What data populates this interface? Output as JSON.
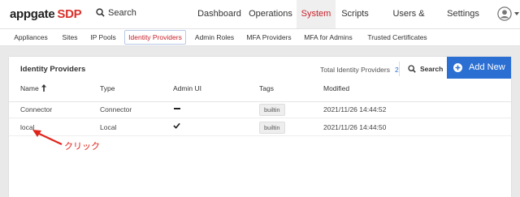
{
  "header": {
    "logo_left": "appgate",
    "logo_right": "SDP",
    "search_label": "Search",
    "nav": [
      {
        "label": "Dashboard"
      },
      {
        "label": "Operations"
      },
      {
        "label": "System",
        "active": true
      },
      {
        "label": "Scripts"
      },
      {
        "label": "Users & Devices"
      },
      {
        "label": "Settings"
      }
    ]
  },
  "subnav": {
    "items": [
      {
        "label": "Appliances"
      },
      {
        "label": "Sites"
      },
      {
        "label": "IP Pools"
      },
      {
        "label": "Identity Providers",
        "active": true
      },
      {
        "label": "Admin Roles"
      },
      {
        "label": "MFA Providers"
      },
      {
        "label": "MFA for Admins"
      },
      {
        "label": "Trusted Certificates"
      }
    ]
  },
  "panel": {
    "title": "Identity Providers",
    "total_label": "Total Identity Providers",
    "total_count": "2",
    "search_label": "Search",
    "add_label": "Add New",
    "columns": [
      "Name",
      "Type",
      "Admin UI",
      "Tags",
      "Modified"
    ],
    "rows": [
      {
        "name": "Connector",
        "type": "Connector",
        "admin_ui": "dash",
        "tag": "builtin",
        "modified": "2021/11/26 14:44:52"
      },
      {
        "name": "local",
        "type": "Local",
        "admin_ui": "check",
        "tag": "builtin",
        "modified": "2021/11/26 14:44:50"
      }
    ]
  },
  "annotation": {
    "text": "クリック",
    "color": "#e0241b"
  },
  "colors": {
    "accent_red": "#c8202a",
    "button_blue": "#2b6fd3",
    "count_blue": "#2c6ecb"
  }
}
